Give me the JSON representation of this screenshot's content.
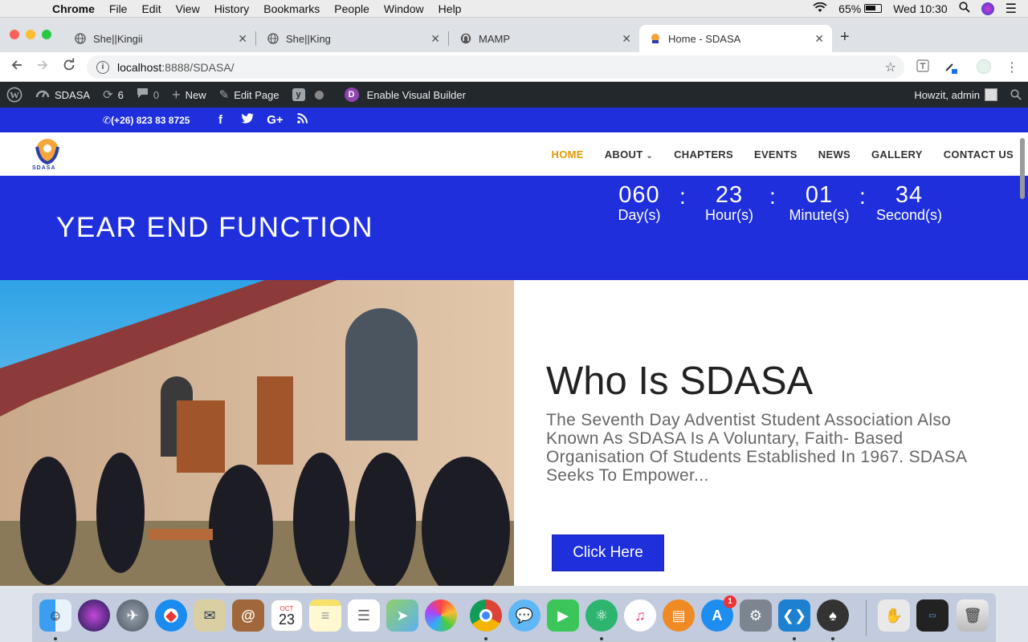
{
  "menubar": {
    "app": "Chrome",
    "items": [
      "File",
      "Edit",
      "View",
      "History",
      "Bookmarks",
      "People",
      "Window",
      "Help"
    ],
    "battery": "65%",
    "clock": "Wed 10:30"
  },
  "tabs": [
    {
      "title": "She||Kingii"
    },
    {
      "title": "She||King"
    },
    {
      "title": "MAMP"
    },
    {
      "title": "Home - SDASA"
    }
  ],
  "omnibox": {
    "host": "localhost",
    "rest": ":8888/SDASA/"
  },
  "adminbar": {
    "site": "SDASA",
    "updates": "6",
    "comments": "0",
    "new": "New",
    "edit": "Edit Page",
    "builder": "Enable Visual Builder",
    "greeting": "Howzit, admin"
  },
  "topbar": {
    "phone": "(+26) 823 83 8725"
  },
  "nav": {
    "items": [
      "HOME",
      "ABOUT",
      "CHAPTERS",
      "EVENTS",
      "NEWS",
      "GALLERY",
      "CONTACT US"
    ]
  },
  "logo_text": "SDASA",
  "hero": {
    "title": "YEAR END FUNCTION",
    "countdown": [
      {
        "value": "060",
        "label": "Day(s)"
      },
      {
        "value": "23",
        "label": "Hour(s)"
      },
      {
        "value": "01",
        "label": "Minute(s)"
      },
      {
        "value": "34",
        "label": "Second(s)"
      }
    ],
    "sep": ":"
  },
  "about": {
    "heading": "Who Is SDASA",
    "body": "The Seventh Day Adventist Student Association Also Known As SDASA Is A Voluntary, Faith- Based Organisation Of Students Established In 1967. SDASA Seeks To Empower...",
    "button": "Click Here"
  },
  "dock": {
    "calendar_month": "OCT",
    "calendar_day": "23",
    "appstore_badge": "1"
  },
  "colors": {
    "brand_blue": "#1f2fdb",
    "nav_active": "#e09900",
    "admin_bar": "#23282d"
  }
}
